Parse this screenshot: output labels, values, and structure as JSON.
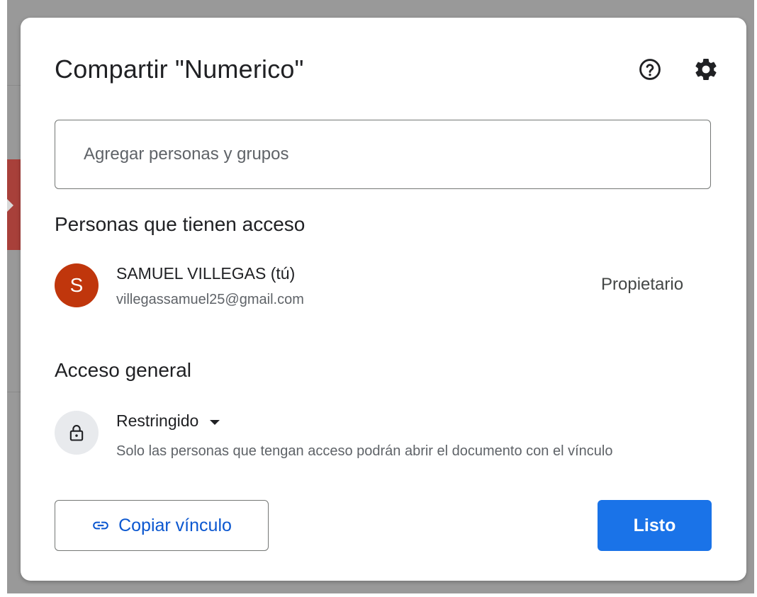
{
  "dialog": {
    "title": "Compartir \"Numerico\"",
    "help_icon": "help-circle-icon",
    "settings_icon": "gear-icon"
  },
  "add_people": {
    "value": "",
    "placeholder": "Agregar personas y grupos"
  },
  "people_section": {
    "heading": "Personas que tienen acceso",
    "people": [
      {
        "avatar_letter": "S",
        "avatar_color": "#c0360c",
        "name": "SAMUEL VILLEGAS (tú)",
        "email": "villegassamuel25@gmail.com",
        "role": "Propietario"
      }
    ]
  },
  "general_access": {
    "heading": "Acceso general",
    "icon": "lock-icon",
    "level": "Restringido",
    "description": "Solo las personas que tengan acceso podrán abrir el documento con el vínculo"
  },
  "actions": {
    "copy_link_label": "Copiar vínculo",
    "copy_link_icon": "link-icon",
    "done_label": "Listo"
  },
  "colors": {
    "accent": "#1a73e8",
    "link_text": "#0b57d0",
    "avatar": "#c0360c"
  }
}
